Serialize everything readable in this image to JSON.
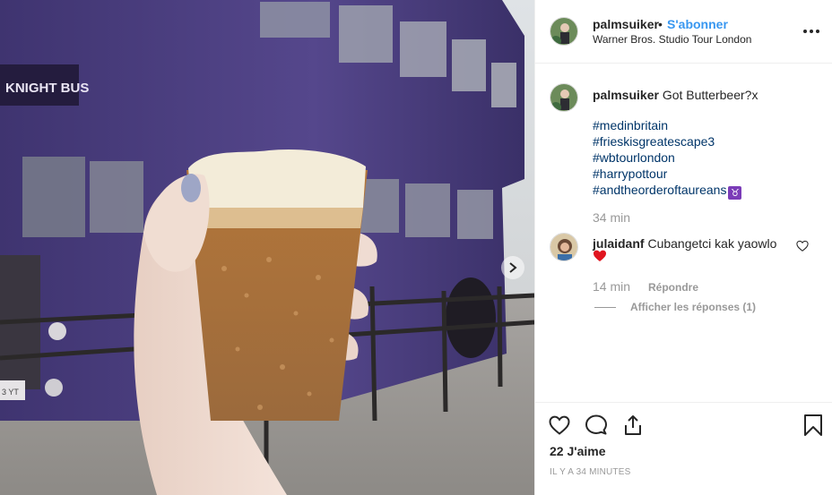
{
  "post": {
    "username": "palmsuiker",
    "separator": "•",
    "follow_label": "S'abonner",
    "location": "Warner Bros. Studio Tour London",
    "more_icon": "more-options-icon",
    "caption": "Got Butterbeer?x",
    "hashtags": [
      "#medinbritain",
      "#frieskisgreatescape3",
      "#wbtourlondon",
      "#harrypottour",
      "#andtheorderoftaureans"
    ],
    "zodiac_emoji": "♉",
    "caption_time": "34 min"
  },
  "photo": {
    "bus_sign": "KNIGHT BUS",
    "plate": "3 YT",
    "next_icon": "chevron-right-icon"
  },
  "reply": {
    "username": "julaidanf",
    "text": "Cubangetci kak yaowlo",
    "emoji_icon": "red-heart-icon",
    "time": "14 min",
    "reply_label": "Répondre",
    "view_replies": "Afficher les réponses (1)"
  },
  "actions": {
    "like_icon": "heart-icon",
    "comment_icon": "comment-icon",
    "share_icon": "share-icon",
    "save_icon": "bookmark-icon",
    "likes": "22 J'aime",
    "posted_ago": "IL Y A 34 MINUTES"
  },
  "colors": {
    "link_blue": "#3897f0",
    "hashtag": "#003569",
    "muted": "#999999",
    "text": "#262626",
    "bus_purple": "#4b3f7e"
  }
}
